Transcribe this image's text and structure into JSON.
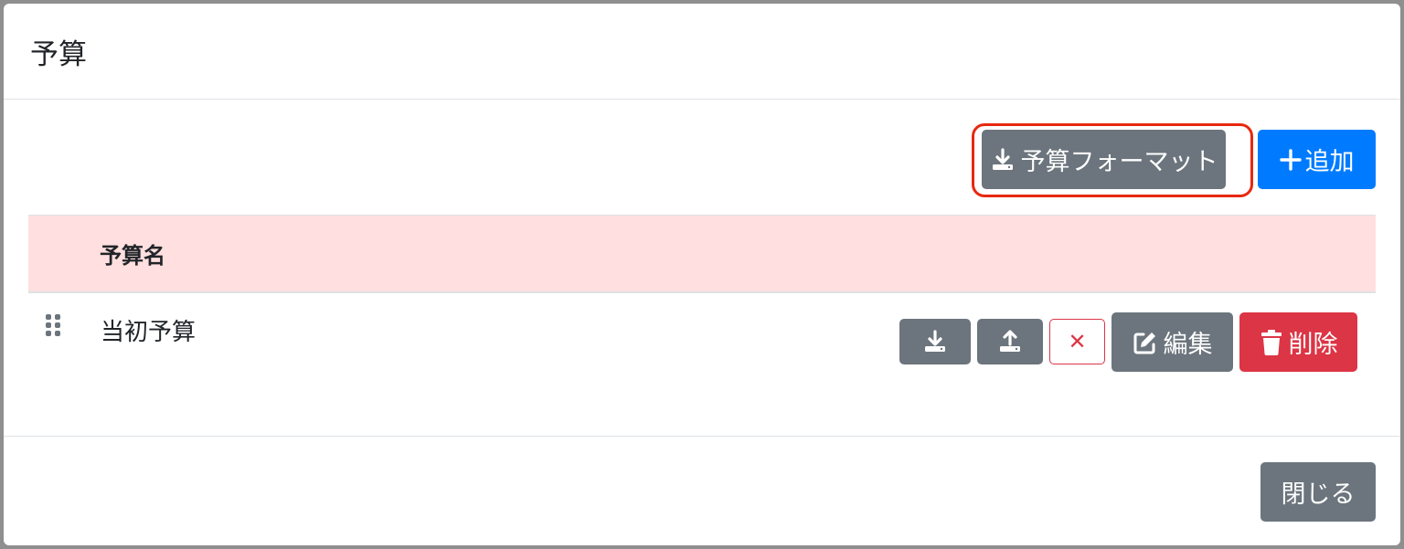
{
  "modal": {
    "title": "予算"
  },
  "toolbar": {
    "format_button_label": "予算フォーマット",
    "add_button_label": "追加"
  },
  "table": {
    "columns": [
      "予算名"
    ],
    "rows": [
      {
        "name": "当初予算"
      }
    ]
  },
  "row_actions": {
    "edit_label": "編集",
    "delete_label": "削除",
    "remove_symbol": "✕"
  },
  "footer": {
    "close_label": "閉じる"
  },
  "colors": {
    "secondary": "#6c757d",
    "primary": "#007bff",
    "danger": "#dc3545",
    "header_row_bg": "#ffdfdf",
    "highlight": "#e8280f"
  },
  "icons": {
    "format_button": "download-icon",
    "add_button": "plus-icon",
    "row_download": "download-icon",
    "row_upload": "upload-icon",
    "row_remove": "close-icon",
    "edit_button": "edit-icon",
    "delete_button": "trash-icon",
    "drag": "drag-handle-icon"
  }
}
